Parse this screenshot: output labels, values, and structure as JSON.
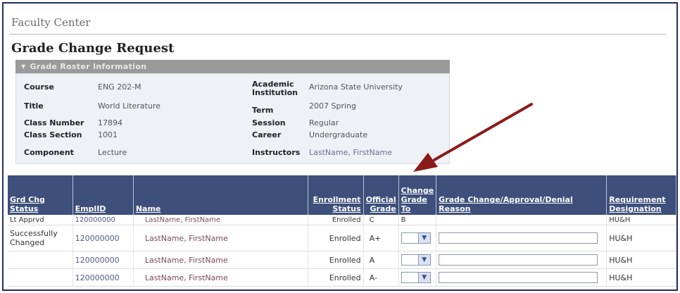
{
  "header": {
    "app_title": "Faculty Center",
    "page_title": "Grade Change Request"
  },
  "roster": {
    "section_title": "Grade Roster Information",
    "left": [
      {
        "label": "Course",
        "value": "ENG 202-M"
      },
      {
        "label": "Title",
        "value": "World Literature"
      },
      {
        "label": "Class Number",
        "value": "17894"
      },
      {
        "label": "Class Section",
        "value": "1001"
      },
      {
        "label": "Component",
        "value": "Lecture"
      }
    ],
    "right": [
      {
        "label": "Academic Institution",
        "value": "Arizona State University"
      },
      {
        "label": "Term",
        "value": "2007 Spring"
      },
      {
        "label": "Session",
        "value": "Regular"
      },
      {
        "label": "Career",
        "value": "Undergraduate"
      },
      {
        "label": "Instructors",
        "value": "LastName, FirstName"
      }
    ]
  },
  "grid": {
    "columns": [
      "Grd Chg Status",
      "EmplID",
      "Name",
      "Enrollment Status",
      "Official Grade",
      "Change Grade To",
      "Grade Change/Approval/Denial Reason",
      "Requirement Designation"
    ],
    "rows": [
      {
        "status": "Lt Apprvd",
        "emplid": "120000000",
        "name": "LastName, FirstName",
        "enrollment": "Enrolled",
        "official": "C",
        "change_to": "B",
        "reason": "",
        "designation": "HU&H"
      },
      {
        "status": "Successfully Changed",
        "emplid": "120000000",
        "name": "LastName, FirstName",
        "enrollment": "Enrolled",
        "official": "A+",
        "change_to": "",
        "reason": "",
        "designation": "HU&H"
      },
      {
        "status": "",
        "emplid": "120000000",
        "name": "LastName, FirstName",
        "enrollment": "Enrolled",
        "official": "A",
        "change_to": "",
        "reason": "",
        "designation": "HU&H"
      },
      {
        "status": "",
        "emplid": "120000000",
        "name": "LastName, FirstName",
        "enrollment": "Enrolled",
        "official": "A-",
        "change_to": "",
        "reason": "",
        "designation": "HU&H"
      }
    ]
  },
  "colors": {
    "header_bg": "#3d4f7a",
    "arrow": "#8b1a1a",
    "section_bar": "#9a9a9a"
  }
}
